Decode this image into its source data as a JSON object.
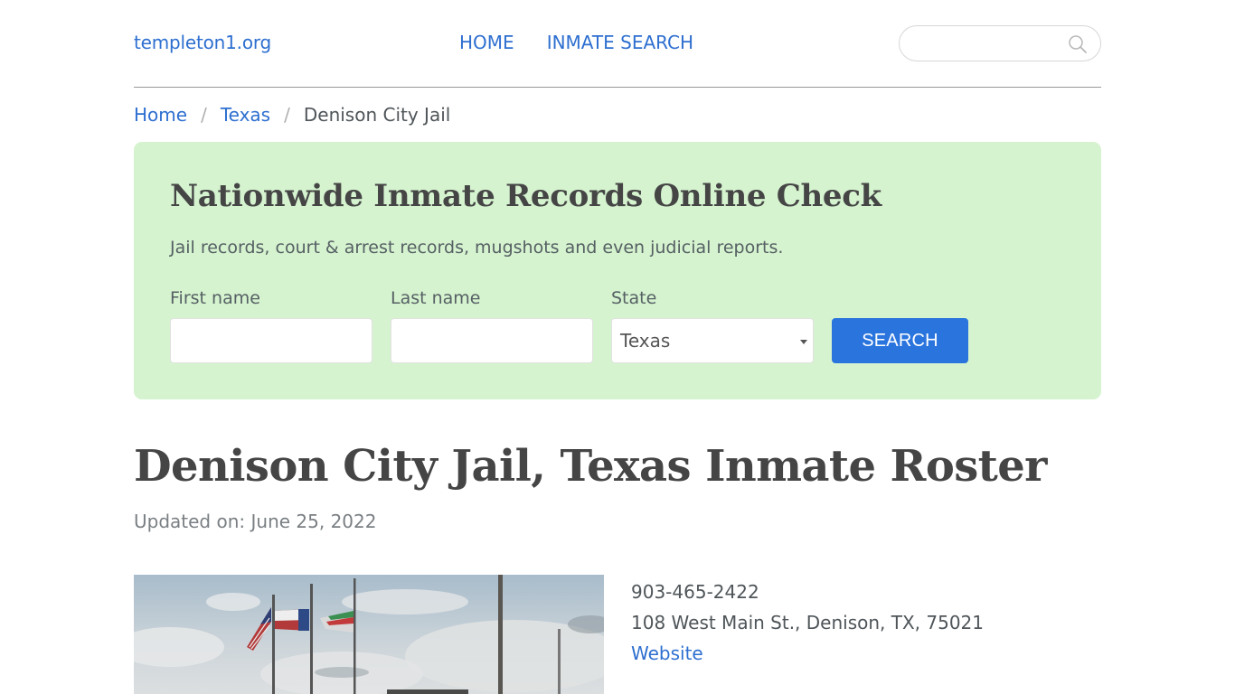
{
  "header": {
    "logo": "templeton1.org",
    "nav": [
      {
        "label": "HOME"
      },
      {
        "label": "INMATE SEARCH"
      }
    ],
    "search": {
      "placeholder": "",
      "value": "",
      "icon": "search-icon"
    }
  },
  "breadcrumb": {
    "items": [
      {
        "label": "Home"
      },
      {
        "label": "Texas"
      }
    ],
    "separator": "/",
    "current": "Denison City Jail"
  },
  "hero": {
    "title": "Nationwide Inmate Records Online Check",
    "subtitle": "Jail records, court & arrest records, mugshots and even judicial reports.",
    "first_name": {
      "label": "First name",
      "value": ""
    },
    "last_name": {
      "label": "Last name",
      "value": ""
    },
    "state": {
      "label": "State",
      "value": "Texas"
    },
    "button": "SEARCH",
    "colors": {
      "background": "#d5f3cf",
      "button": "#2a74de"
    }
  },
  "page": {
    "title": "Denison City Jail, Texas Inmate Roster",
    "updated": "Updated on: June 25, 2022"
  },
  "facility": {
    "photo": "facility-photo-flags",
    "phone": "903-465-2422",
    "address": "108 West Main St., Denison, TX, 75021",
    "website_label": "Website"
  },
  "colors": {
    "link": "#2e6fd0",
    "text": "#4a4a4a"
  }
}
